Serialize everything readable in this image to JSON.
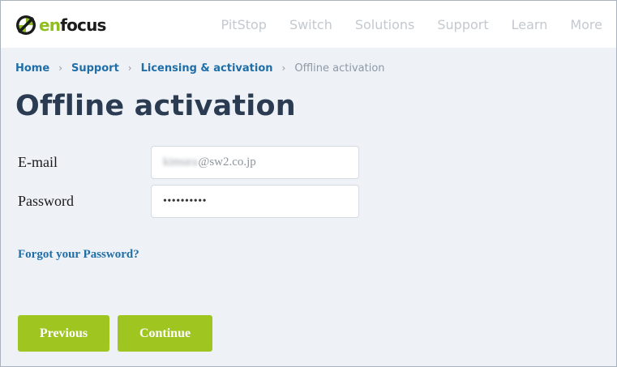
{
  "header": {
    "logo": {
      "prefix": "en",
      "suffix": "focus"
    },
    "nav": [
      "PitStop",
      "Switch",
      "Solutions",
      "Support",
      "Learn",
      "More"
    ]
  },
  "breadcrumb": {
    "items": [
      "Home",
      "Support",
      "Licensing & activation"
    ],
    "current": "Offline activation",
    "separator": "›"
  },
  "page": {
    "title": "Offline activation"
  },
  "form": {
    "email": {
      "label": "E-mail",
      "value_obscured": "kimura",
      "value_domain": "@sw2.co.jp"
    },
    "password": {
      "label": "Password",
      "value": "••••••••••"
    },
    "forgot_link": "Forgot your Password?"
  },
  "buttons": {
    "previous": "Previous",
    "continue": "Continue"
  },
  "colors": {
    "accent": "#9fc520",
    "link": "#1f6ea8",
    "title": "#2b3c52",
    "background": "#eef2f7"
  }
}
